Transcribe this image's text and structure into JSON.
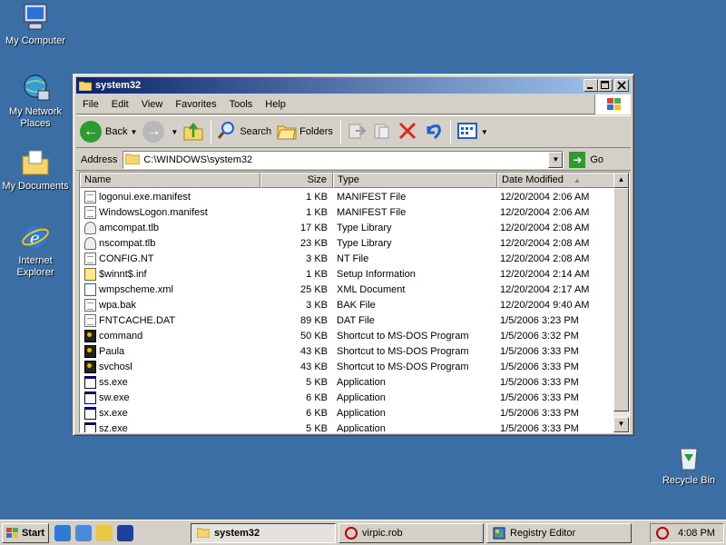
{
  "desktop": {
    "icons": [
      {
        "label": "My Computer"
      },
      {
        "label": "My Network Places"
      },
      {
        "label": "My Documents"
      },
      {
        "label": "Internet Explorer"
      },
      {
        "label": "Recycle Bin"
      }
    ]
  },
  "window": {
    "title": "system32",
    "menu": [
      "File",
      "Edit",
      "View",
      "Favorites",
      "Tools",
      "Help"
    ],
    "toolbar": {
      "back": "Back",
      "search": "Search",
      "folders": "Folders"
    },
    "address": {
      "label": "Address",
      "value": "C:\\WINDOWS\\system32",
      "go": "Go"
    },
    "columns": {
      "name": "Name",
      "size": "Size",
      "type": "Type",
      "date": "Date Modified"
    },
    "files": [
      {
        "icon": "doc",
        "name": "logonui.exe.manifest",
        "size": "1 KB",
        "type": "MANIFEST File",
        "date": "12/20/2004 2:06 AM"
      },
      {
        "icon": "doc",
        "name": "WindowsLogon.manifest",
        "size": "1 KB",
        "type": "MANIFEST File",
        "date": "12/20/2004 2:06 AM"
      },
      {
        "icon": "tlb",
        "name": "amcompat.tlb",
        "size": "17 KB",
        "type": "Type Library",
        "date": "12/20/2004 2:08 AM"
      },
      {
        "icon": "tlb",
        "name": "nscompat.tlb",
        "size": "23 KB",
        "type": "Type Library",
        "date": "12/20/2004 2:08 AM"
      },
      {
        "icon": "doc",
        "name": "CONFIG.NT",
        "size": "3 KB",
        "type": "NT File",
        "date": "12/20/2004 2:08 AM"
      },
      {
        "icon": "inf",
        "name": "$winnt$.inf",
        "size": "1 KB",
        "type": "Setup Information",
        "date": "12/20/2004 2:14 AM"
      },
      {
        "icon": "xml",
        "name": "wmpscheme.xml",
        "size": "25 KB",
        "type": "XML Document",
        "date": "12/20/2004 2:17 AM"
      },
      {
        "icon": "doc",
        "name": "wpa.bak",
        "size": "3 KB",
        "type": "BAK File",
        "date": "12/20/2004 9:40 AM"
      },
      {
        "icon": "doc",
        "name": "FNTCACHE.DAT",
        "size": "89 KB",
        "type": "DAT File",
        "date": "1/5/2006 3:23 PM"
      },
      {
        "icon": "msdos",
        "name": "command",
        "size": "50 KB",
        "type": "Shortcut to MS-DOS Program",
        "date": "1/5/2006 3:32 PM"
      },
      {
        "icon": "msdos",
        "name": "Paula",
        "size": "43 KB",
        "type": "Shortcut to MS-DOS Program",
        "date": "1/5/2006 3:33 PM"
      },
      {
        "icon": "msdos",
        "name": "svchosl",
        "size": "43 KB",
        "type": "Shortcut to MS-DOS Program",
        "date": "1/5/2006 3:33 PM"
      },
      {
        "icon": "app",
        "name": "ss.exe",
        "size": "5 KB",
        "type": "Application",
        "date": "1/5/2006 3:33 PM"
      },
      {
        "icon": "app",
        "name": "sw.exe",
        "size": "6 KB",
        "type": "Application",
        "date": "1/5/2006 3:33 PM"
      },
      {
        "icon": "app",
        "name": "sx.exe",
        "size": "6 KB",
        "type": "Application",
        "date": "1/5/2006 3:33 PM"
      },
      {
        "icon": "app",
        "name": "sz.exe",
        "size": "5 KB",
        "type": "Application",
        "date": "1/5/2006 3:33 PM"
      }
    ]
  },
  "taskbar": {
    "start": "Start",
    "tasks": [
      {
        "label": "system32",
        "active": true
      },
      {
        "label": "virpic.rob",
        "active": false
      },
      {
        "label": "Registry Editor",
        "active": false
      }
    ],
    "clock": "4:08 PM"
  },
  "colors": {
    "desktop": "#3a6ea5",
    "titlebar_start": "#0a246a",
    "titlebar_end": "#a6caf0",
    "face": "#d4d0c8"
  }
}
